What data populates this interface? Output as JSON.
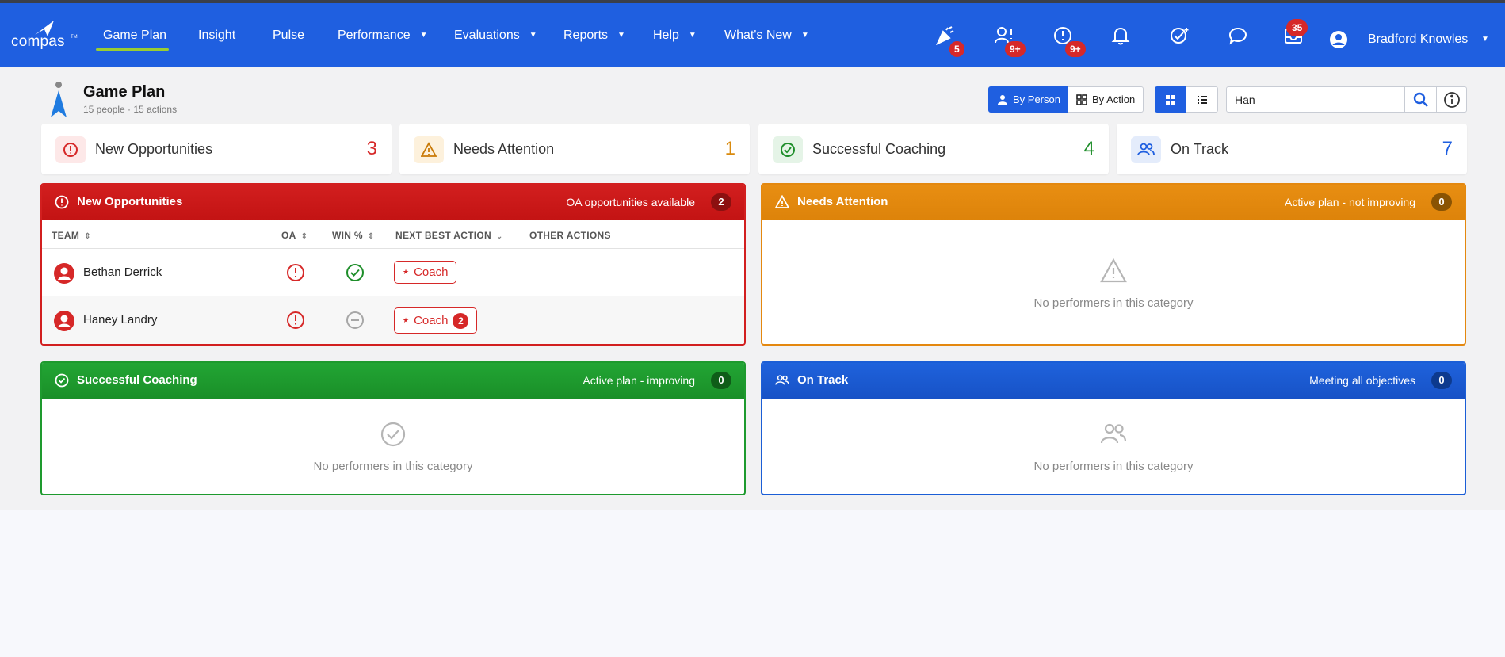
{
  "app": {
    "logo_text": "compas",
    "logo_tm": "TM"
  },
  "nav": {
    "items": [
      {
        "label": "Game Plan",
        "active": true
      },
      {
        "label": "Insight"
      },
      {
        "label": "Pulse"
      },
      {
        "label": "Performance",
        "dropdown": true
      },
      {
        "label": "Evaluations",
        "dropdown": true
      },
      {
        "label": "Reports",
        "dropdown": true
      },
      {
        "label": "Help",
        "dropdown": true
      },
      {
        "label": "What's New",
        "dropdown": true
      }
    ],
    "icons": [
      {
        "name": "celebration-icon",
        "badge": "5"
      },
      {
        "name": "person-alert-icon",
        "badge": "9+"
      },
      {
        "name": "alert-circle-icon",
        "badge": "9+"
      },
      {
        "name": "bell-icon"
      },
      {
        "name": "check-sparkle-icon"
      },
      {
        "name": "chat-icon"
      },
      {
        "name": "inbox-icon",
        "badge": "35"
      }
    ],
    "user_name": "Bradford Knowles"
  },
  "page": {
    "title": "Game Plan",
    "subtitle": "15 people · 15 actions",
    "by_person": "By Person",
    "by_action": "By Action",
    "search_value": "Han"
  },
  "summary": [
    {
      "label": "New Opportunities",
      "count": "3",
      "color": "#d62828"
    },
    {
      "label": "Needs Attention",
      "count": "1",
      "color": "#d98a0e"
    },
    {
      "label": "Successful Coaching",
      "count": "4",
      "color": "#1e8e2a"
    },
    {
      "label": "On Track",
      "count": "7",
      "color": "#1f5fe0"
    }
  ],
  "panels": {
    "new_opportunities": {
      "title": "New Opportunities",
      "meta": "OA opportunities available",
      "count": "2",
      "color": "#d21f1f",
      "columns": [
        "TEAM",
        "OA",
        "WIN %",
        "NEXT BEST ACTION",
        "OTHER ACTIONS"
      ],
      "rows": [
        {
          "name": "Bethan Derrick",
          "oa": "alert",
          "win": "check",
          "action": "Coach",
          "action_count": ""
        },
        {
          "name": "Haney Landry",
          "oa": "alert",
          "win": "neutral",
          "action": "Coach",
          "action_count": "2"
        }
      ]
    },
    "needs_attention": {
      "title": "Needs Attention",
      "meta": "Active plan - not improving",
      "count": "0",
      "color": "#e4880f",
      "empty": "No performers in this category"
    },
    "successful_coaching": {
      "title": "Successful Coaching",
      "meta": "Active plan - improving",
      "count": "0",
      "color": "#1e9a2e",
      "empty": "No performers in this category"
    },
    "on_track": {
      "title": "On Track",
      "meta": "Meeting all objectives",
      "count": "0",
      "color": "#1b5ed6",
      "empty": "No performers in this category"
    }
  }
}
